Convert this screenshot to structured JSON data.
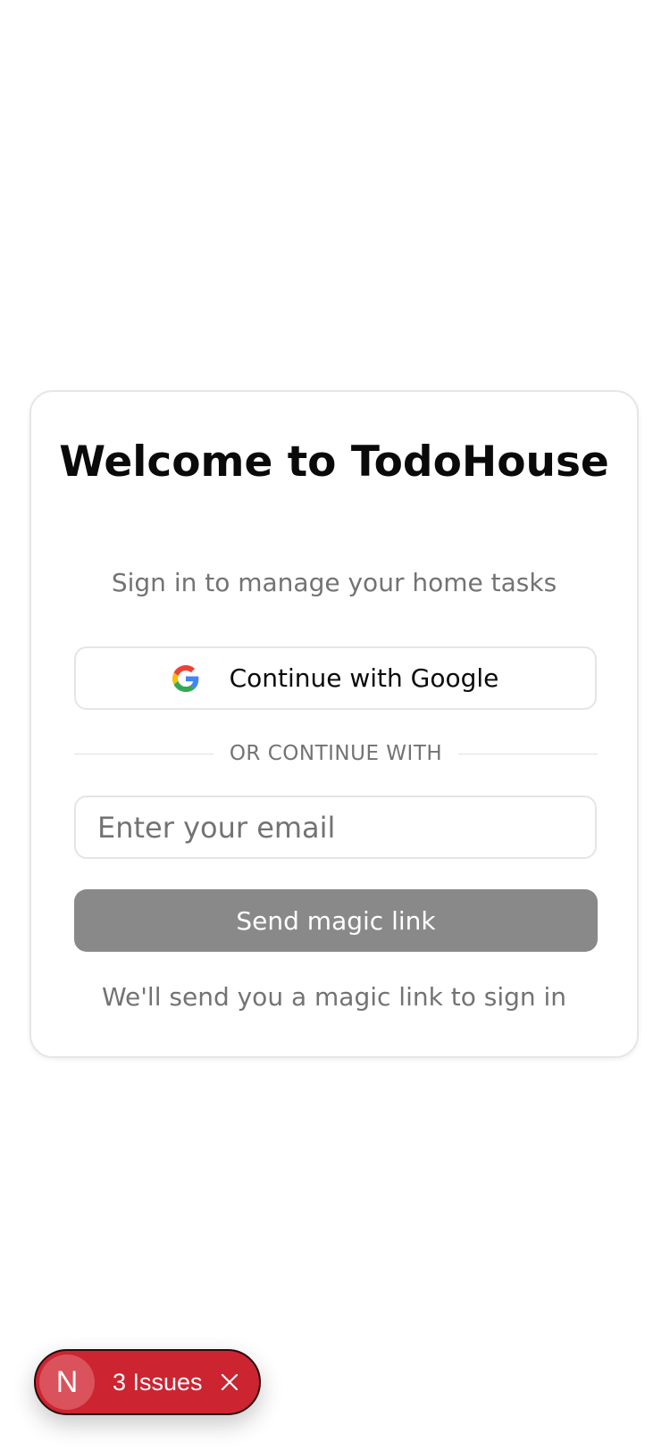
{
  "login": {
    "title": "Welcome to TodoHouse",
    "subtitle": "Sign in to manage your home tasks",
    "google_button_label": "Continue with Google",
    "divider_text": "OR CONTINUE WITH",
    "email_placeholder": "Enter your email",
    "email_value": "",
    "send_button_label": "Send magic link",
    "hint": "We'll send you a magic link to sign in"
  },
  "dev_overlay": {
    "badge_letter": "N",
    "issues_label": "3 Issues",
    "issue_count": 3
  },
  "colors": {
    "send_button_bg": "#898989",
    "issues_pill_bg": "#cc2431",
    "muted_text": "#737373"
  },
  "icons": {
    "google": "google-logo-icon",
    "close": "close-icon"
  }
}
